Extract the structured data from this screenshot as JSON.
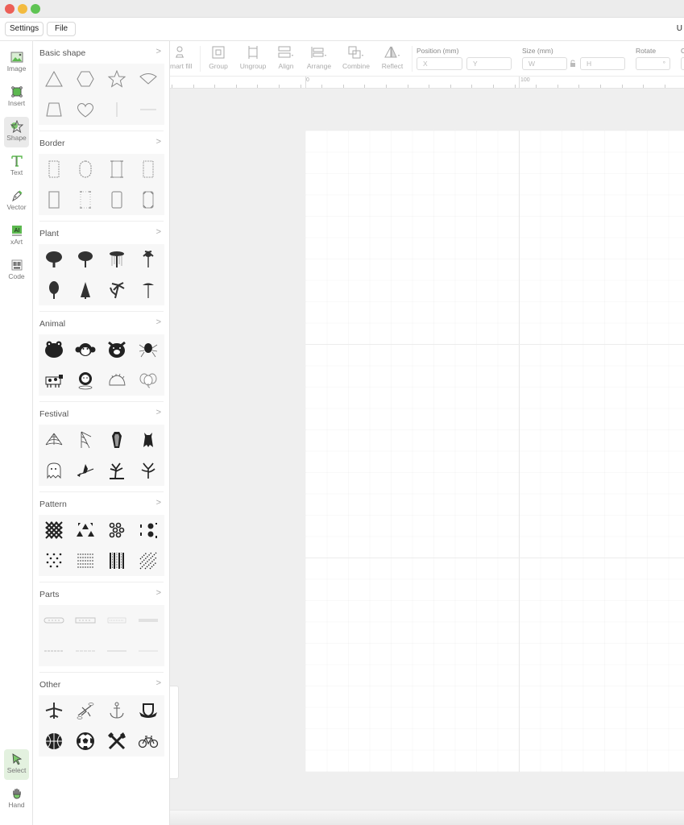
{
  "window": {
    "title_right_text": "U"
  },
  "menubar": {
    "settings_label": "Settings",
    "file_label": "File"
  },
  "toolrail": {
    "items": [
      {
        "label": "Image",
        "icon": "image-icon",
        "active": false
      },
      {
        "label": "Insert",
        "icon": "insert-icon",
        "active": false
      },
      {
        "label": "Shape",
        "icon": "star-shape-icon",
        "active": true
      },
      {
        "label": "Text",
        "icon": "text-icon",
        "active": false
      },
      {
        "label": "Vector",
        "icon": "pen-icon",
        "active": false
      },
      {
        "label": "xArt",
        "icon": "ai-icon",
        "active": false
      },
      {
        "label": "Code",
        "icon": "barcode-icon",
        "active": false
      }
    ],
    "bottom_items": [
      {
        "label": "Select",
        "icon": "cursor-icon",
        "active": true
      },
      {
        "label": "Hand",
        "icon": "hand-icon",
        "active": false
      }
    ]
  },
  "panel": {
    "sections": [
      {
        "title": "Basic shape",
        "items": [
          "triangle",
          "hexagon",
          "star",
          "fan",
          "trapezoid",
          "heart",
          "vertical-line",
          "horizontal-line"
        ]
      },
      {
        "title": "Border",
        "items": [
          "border-1",
          "border-oval",
          "border-3",
          "border-4",
          "border-5",
          "border-6",
          "border-7",
          "border-8"
        ]
      },
      {
        "title": "Plant",
        "items": [
          "tree-round",
          "tree-broad",
          "tree-willow",
          "palm-small",
          "tree-tall",
          "pine-tree",
          "palm-tree",
          "umbrella-tree"
        ]
      },
      {
        "title": "Animal",
        "items": [
          "frog",
          "monkey",
          "pig",
          "spider",
          "cow",
          "lion",
          "hedgehog",
          "elephant"
        ]
      },
      {
        "title": "Festival",
        "items": [
          "spider-web",
          "web-corner",
          "coffin",
          "bat",
          "ghost",
          "witch",
          "haunted-tree",
          "spooky-tree"
        ]
      },
      {
        "title": "Pattern",
        "items": [
          "lattice",
          "triangles",
          "rings",
          "gears",
          "dots",
          "dashes",
          "stripes",
          "diagonal-dots"
        ]
      },
      {
        "title": "Parts",
        "items": [
          "part-1",
          "part-2",
          "part-3",
          "part-4",
          "part-5",
          "part-6",
          "part-7",
          "part-8"
        ]
      },
      {
        "title": "Other",
        "items": [
          "airplane",
          "airplane-clouds",
          "anchor",
          "shield-banner",
          "basketball",
          "soccer-ball",
          "crossed-tools",
          "bicycle"
        ]
      }
    ]
  },
  "toolbar": {
    "items": [
      {
        "label": "Smart fill",
        "display": "mart fill",
        "icon": "smart-fill-icon"
      },
      {
        "label": "Group",
        "icon": "group-icon"
      },
      {
        "label": "Ungroup",
        "icon": "ungroup-icon"
      },
      {
        "label": "Align",
        "icon": "align-icon"
      },
      {
        "label": "Arrange",
        "icon": "arrange-icon"
      },
      {
        "label": "Combine",
        "icon": "combine-icon"
      },
      {
        "label": "Reflect",
        "icon": "reflect-icon"
      }
    ],
    "position_label": "Position (mm)",
    "size_label": "Size (mm)",
    "rotate_label": "Rotate",
    "x_placeholder": "X",
    "y_placeholder": "Y",
    "w_placeholder": "W",
    "h_placeholder": "H",
    "rotate_unit": "°",
    "x_value": "",
    "y_value": "",
    "w_value": "",
    "h_value": "",
    "rotate_value": ""
  },
  "ruler": {
    "labels": [
      "0",
      "100"
    ]
  }
}
